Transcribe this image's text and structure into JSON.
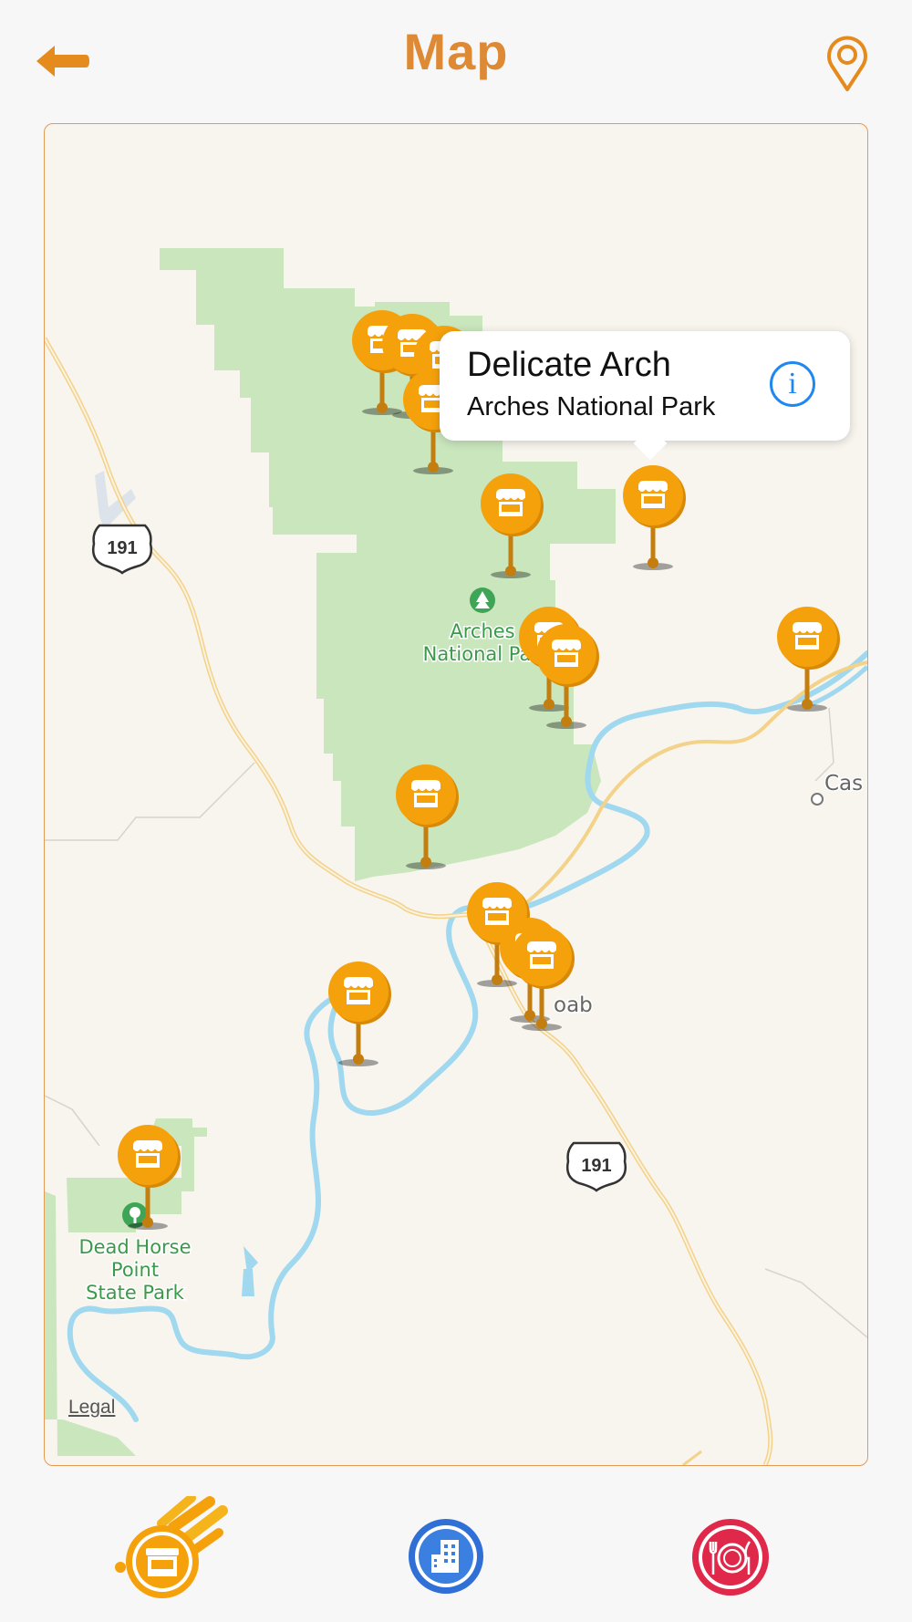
{
  "header": {
    "title": "Map",
    "back_icon": "arrow-left-icon",
    "locate_icon": "location-pin-icon"
  },
  "colors": {
    "accent": "#de8a35",
    "pin_orange": "#f5a10c",
    "park_green": "#c9e6bd",
    "water": "#9fd8ef",
    "road": "#f3d28a",
    "info_blue": "#1e88f0",
    "hotel_blue": "#2f6fd6",
    "food_red": "#e0284a"
  },
  "map": {
    "labels": {
      "arches_line1": "Arches",
      "arches_line2": "National Pa",
      "dead_horse_line1": "Dead Horse",
      "dead_horse_line2": "Point",
      "dead_horse_line3": "State Park",
      "moab": "oab",
      "castle": "Cas",
      "route_shield_north": "191",
      "route_shield_south": "191"
    },
    "callout": {
      "title": "Delicate Arch",
      "subtitle": "Arches National Park",
      "info_label": "i"
    },
    "legal_label": "Legal",
    "pin_icon": "shop-pin-icon"
  },
  "tabbar": {
    "items": [
      {
        "name": "shops",
        "icon": "shop-icon",
        "selected": true
      },
      {
        "name": "hotels",
        "icon": "building-icon",
        "selected": false
      },
      {
        "name": "restaurants",
        "icon": "plate-cutlery-icon",
        "selected": false
      }
    ]
  }
}
